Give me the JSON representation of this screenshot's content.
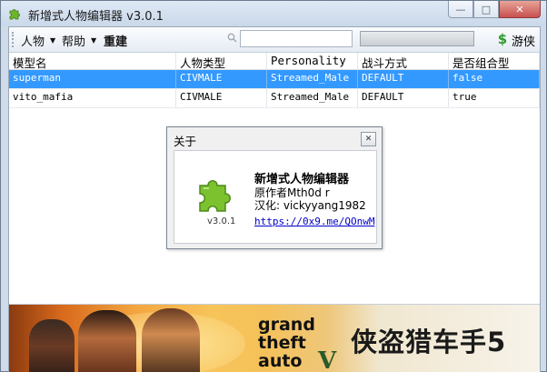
{
  "window": {
    "title": "新增式人物编辑器 v3.0.1"
  },
  "titlebar_buttons": {
    "minimize": "—",
    "maximize": "□",
    "close": "✕"
  },
  "toolbar": {
    "menu_person": "人物",
    "menu_help": "帮助",
    "rebuild": "重建",
    "search_value": "",
    "ranger_label": "游侠"
  },
  "table": {
    "columns": [
      "模型名",
      "人物类型",
      "Personality",
      "战斗方式",
      "是否组合型"
    ],
    "rows": [
      [
        "superman",
        "CIVMALE",
        "Streamed_Male",
        "DEFAULT",
        "false"
      ],
      [
        "vito_mafia",
        "CIVMALE",
        "Streamed_Male",
        "DEFAULT",
        "true"
      ]
    ],
    "selected_row": 0
  },
  "about_dialog": {
    "title": "关于",
    "close": "✕",
    "version": "v3.0.1",
    "app_name": "新增式人物编辑器",
    "author": "原作者Mth0d r",
    "localization": "汉化: vickyyang1982",
    "link": "https://0x9.me/QOnwM"
  },
  "banner": {
    "logo_line1": "grand",
    "logo_line2": "theft",
    "logo_line3": "auto",
    "logo_numeral": "V",
    "title_cn": "侠盗猎车手5"
  },
  "colors": {
    "selection": "#3399ff",
    "accent_green": "#2d9a2d",
    "link": "#0000cc"
  },
  "icons": {
    "app": "puzzle-icon",
    "search": "search-icon",
    "ranger": "dollar-icon"
  }
}
